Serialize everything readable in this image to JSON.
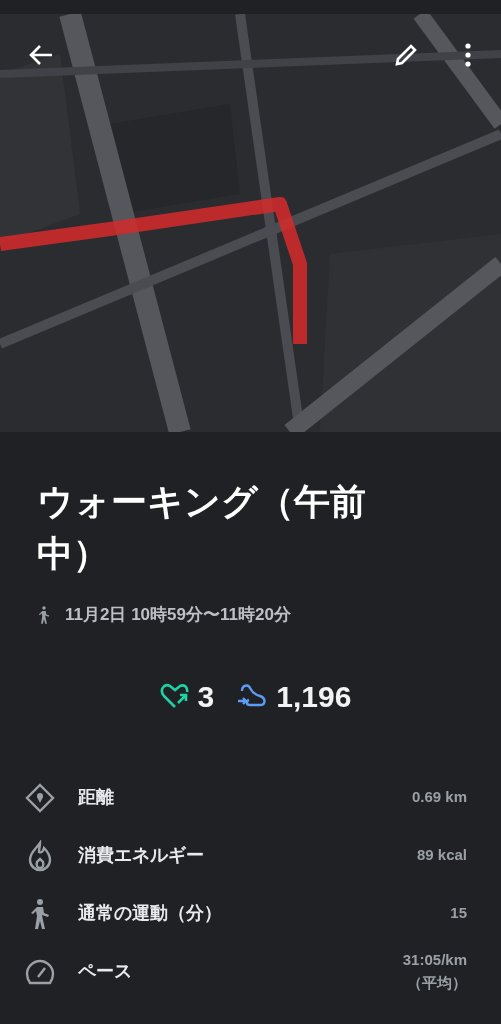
{
  "title": "ウォーキング（午前中）",
  "time_range": "11月2日 10時59分〜11時20分",
  "scores": [
    {
      "kind": "heart",
      "value": "3"
    },
    {
      "kind": "steps",
      "value": "1,196"
    }
  ],
  "metrics": [
    {
      "kind": "distance",
      "label": "距離",
      "value": "0.69 km"
    },
    {
      "kind": "energy",
      "label": "消費エネルギー",
      "value": "89 kcal"
    },
    {
      "kind": "move",
      "label": "通常の運動（分）",
      "value": "15"
    },
    {
      "kind": "pace",
      "label": "ペース",
      "value": "31:05/km",
      "note": "（平均）"
    }
  ]
}
